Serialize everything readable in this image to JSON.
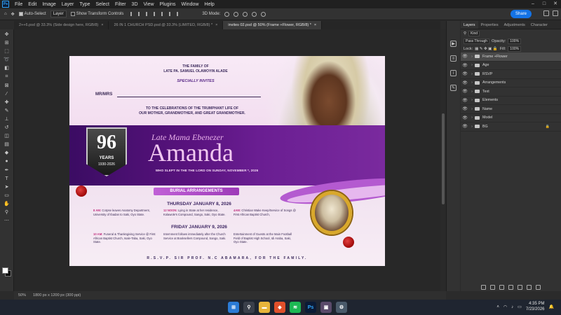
{
  "menubar": {
    "app_logo": "Ps",
    "items": [
      "File",
      "Edit",
      "Image",
      "Layer",
      "Type",
      "Select",
      "Filter",
      "3D",
      "View",
      "Plugins",
      "Window",
      "Help"
    ],
    "window_controls": [
      "–",
      "□",
      "✕"
    ]
  },
  "options": {
    "auto_select_label": "Auto-Select",
    "auto_select_value": "Layer",
    "show_transform_label": "Show Transform Controls",
    "mode_3d_label": "3D Mode:",
    "share_label": "Share"
  },
  "tabs": [
    {
      "label": "2++6.psd @ 33.3% (Side design here, RGB/8)"
    },
    {
      "label": "26 IN 1 CHURCH PSD.psd @ 33.3% (LIMITED, RGB/8) *"
    },
    {
      "label": "invites 02.psd @ 50% (Frame +Flower, RGB/8) *"
    }
  ],
  "document": {
    "family_line1": "THE FAMILY OF",
    "family_line2": "LATE PA. SAMUEL OLAWOYIN ALADE",
    "specially": "SPECIALLY INVITES",
    "mrmrs": "MR/MRS",
    "celebration_line1": "TO THE CELEBRATIONS OF THE TRUMPHANT LIFE OF",
    "celebration_line2": "OUR MOTHER, GRANDMOTHER, AND GREAT GRANDMOTHER.",
    "badge_number": "96",
    "badge_years": "YEARS",
    "badge_range": "1930-2026",
    "late_mama": "Late Mama Ebenezer",
    "amanda": "Amanda",
    "slept": "WHO SLEPT IN THE THE LORD ON SUNDAY, NOVEMBER *, 2026",
    "burial_label": "BURIAL ARRANGEMENTS",
    "day1": "THURSDAY JANUARY 8, 2026",
    "day1_events": [
      {
        "time": "8 AM:",
        "text": "Corpse leaves Anatomy Department, University of Ibadan to Saki, Oyo State."
      },
      {
        "time": "12 NOON:",
        "text": "Lying in State at her residence, Kolawole's Compound, Sango, Saki, Oyo State."
      },
      {
        "time": "4AM:",
        "text": "Christian Wake Keep/Service of Songs @ First African Baptist Church,"
      }
    ],
    "day2": "FRIDAY JANUARY 9, 2026",
    "day2_events": [
      {
        "time": "10 AM:",
        "text": "Funeral & Thanksgiving Service @ First African Baptist Church, Isale-Taba, Saki, Oyo State."
      },
      {
        "time": "",
        "text": "Internment follows immediately after the Church Service at Booksellers Compound, Sango, Saki."
      },
      {
        "time": "",
        "text": "Entertainment of Guests at the Main Football Field of Baptist High School, Idi Araba, Saki, Oyo State."
      }
    ],
    "rsvp": "R.S.V.P. SIR PROF. N.C ABAMARA, FOR THE FAMILY."
  },
  "panel": {
    "tabs": [
      "Layers",
      "Properties",
      "Adjustments",
      "Character"
    ],
    "kind_label": "Kind",
    "blend_mode": "Pass Through",
    "opacity_label": "Opacity:",
    "opacity_value": "100%",
    "lock_label": "Lock:",
    "fill_label": "Fill:",
    "fill_value": "100%",
    "layers": [
      {
        "name": "Frame +Flower",
        "selected": true,
        "locked": false
      },
      {
        "name": "Age",
        "selected": false,
        "locked": false
      },
      {
        "name": "RSVP",
        "selected": false,
        "locked": false
      },
      {
        "name": "Arrangements",
        "selected": false,
        "locked": false
      },
      {
        "name": "Text",
        "selected": false,
        "locked": false
      },
      {
        "name": "Elements",
        "selected": false,
        "locked": false
      },
      {
        "name": "Name",
        "selected": false,
        "locked": false
      },
      {
        "name": "Model",
        "selected": false,
        "locked": false
      },
      {
        "name": "BG",
        "selected": false,
        "locked": true
      }
    ]
  },
  "status": {
    "zoom": "50%",
    "size": "1800 px x 1200 px (300 ppi)"
  },
  "taskbar": {
    "time": "4:35 PM",
    "date": "7/23/2026"
  },
  "colors": {
    "share": "#1473e6",
    "band": "#5a137f",
    "accent_pink": "#c060d6"
  }
}
